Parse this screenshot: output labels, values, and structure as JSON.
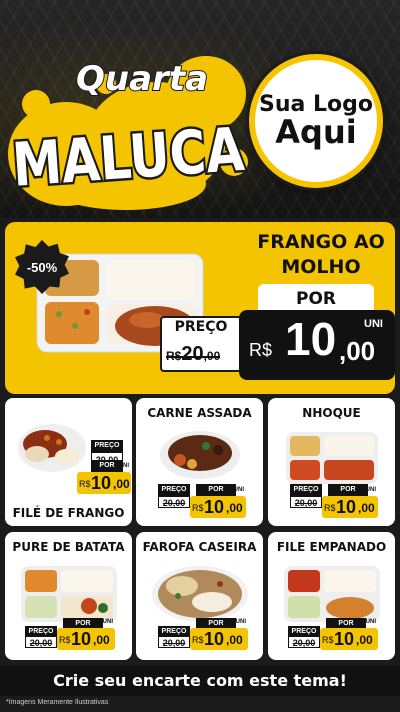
{
  "header": {
    "title_top": "Quarta",
    "title_main": "MALUCA",
    "logo_line1": "Sua Logo",
    "logo_line2": "Aqui"
  },
  "colors": {
    "accent_yellow": "#f5c400",
    "dark": "#111111",
    "background": "#1b1b1b"
  },
  "featured": {
    "discount_badge": "-50%",
    "name": "FRANGO AO MOLHO",
    "por_label": "POR",
    "preco_label": "PREÇO",
    "old_currency": "R$",
    "old_price_int": "20",
    "old_price_dec": ",00",
    "uni_label": "UNI",
    "new_currency": "R$",
    "new_price_int": "10",
    "new_price_dec": ",00"
  },
  "products": [
    {
      "name": "FILÉ DE FRANGO",
      "preco_label": "PREÇO",
      "old_price": "20,00",
      "por_label": "POR",
      "currency": "R$",
      "price_int": "10",
      "price_dec": ",00",
      "uni_label": "UNI"
    },
    {
      "name": "CARNE ASSADA",
      "preco_label": "PREÇO",
      "old_price": "20,00",
      "por_label": "POR",
      "currency": "R$",
      "price_int": "10",
      "price_dec": ",00",
      "uni_label": "UNI"
    },
    {
      "name": "NHOQUE",
      "preco_label": "PREÇO",
      "old_price": "20,00",
      "por_label": "POR",
      "currency": "R$",
      "price_int": "10",
      "price_dec": ",00",
      "uni_label": "UNI"
    },
    {
      "name": "PURE DE BATATA",
      "preco_label": "PREÇO",
      "old_price": "20,00",
      "por_label": "POR",
      "currency": "R$",
      "price_int": "10",
      "price_dec": ",00",
      "uni_label": "UNI"
    },
    {
      "name": "FAROFA CASEIRA",
      "preco_label": "PREÇO",
      "old_price": "20,00",
      "por_label": "POR",
      "currency": "R$",
      "price_int": "10",
      "price_dec": ",00",
      "uni_label": "UNI"
    },
    {
      "name": "FILE EMPANADO",
      "preco_label": "PREÇO",
      "old_price": "20,00",
      "por_label": "POR",
      "currency": "R$",
      "price_int": "10",
      "price_dec": ",00",
      "uni_label": "UNI"
    }
  ],
  "footer": {
    "cta": "Crie seu encarte com este tema!",
    "disclaimer": "*Imagens Meramente Ilustrativas"
  }
}
